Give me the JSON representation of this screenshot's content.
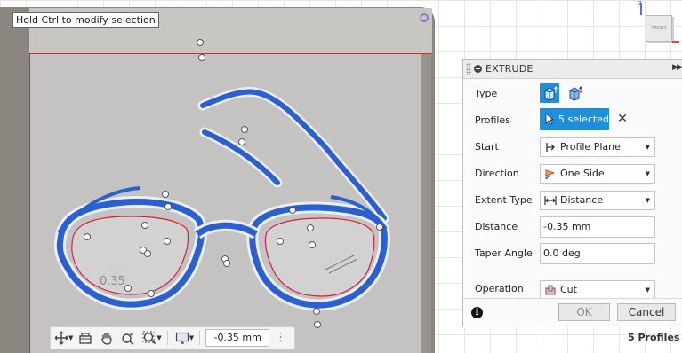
{
  "viewport": {
    "tooltip": "Hold Ctrl to modify selection",
    "ghost_dimension": "0.35"
  },
  "navcube": {
    "face": "FRONT",
    "axis_label": "Z"
  },
  "toolbar": {
    "icons": [
      "orbit-icon",
      "look-at-icon",
      "pan-hand-icon",
      "zoom-icon",
      "fit-icon",
      "display-settings-icon"
    ],
    "value": "-0.35 mm"
  },
  "extrude": {
    "title": "EXTRUDE",
    "labels": {
      "type": "Type",
      "profiles": "Profiles",
      "start": "Start",
      "direction": "Direction",
      "extent_type": "Extent Type",
      "distance": "Distance",
      "taper_angle": "Taper Angle",
      "operation": "Operation"
    },
    "profiles_selected": "5 selected",
    "start": "Profile Plane",
    "direction": "One Side",
    "extent_type": "Distance",
    "distance": "-0.35 mm",
    "taper_angle": "0.0 deg",
    "operation": "Cut",
    "ok": "OK",
    "cancel": "Cancel"
  },
  "status": "5 Profiles",
  "colors": {
    "accent": "#1e8fdc",
    "sketch_blue": "#2c5fcf",
    "profile_red": "#d9203a",
    "viewport_bg": "#c4c3c1"
  }
}
